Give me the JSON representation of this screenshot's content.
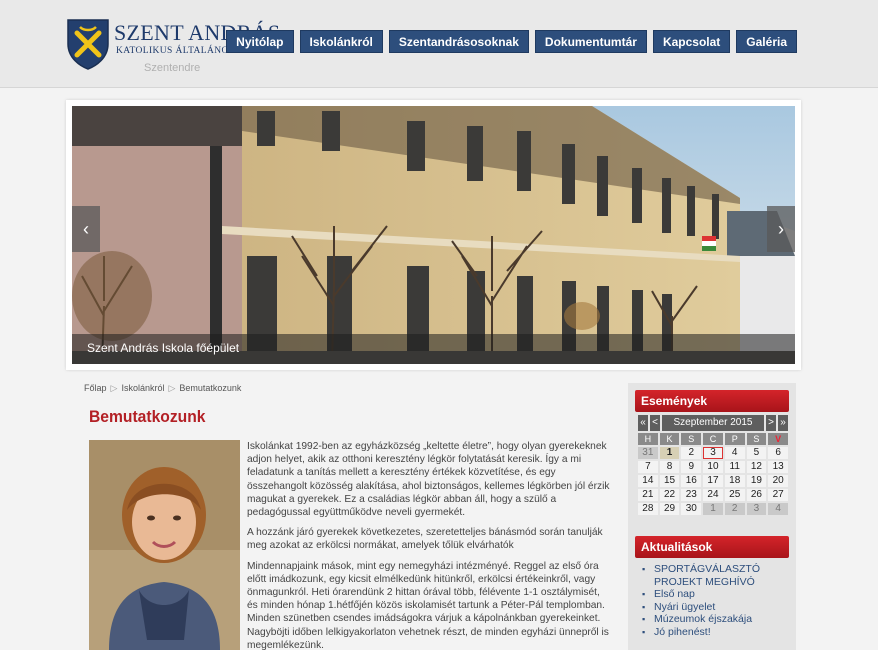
{
  "header": {
    "logo_title": "SZENT ANDRÁS",
    "logo_subtitle": "KATOLIKUS ÁLTALÁNOS ISKOLA",
    "logo_town": "Szentendre"
  },
  "nav": {
    "items": [
      "Nyitólap",
      "Iskolánkról",
      "Szentandrásosoknak",
      "Dokumentumtár",
      "Kapcsolat",
      "Galéria"
    ]
  },
  "slider": {
    "caption": "Szent András Iskola főépület",
    "prev_icon": "chevron-left-icon",
    "next_icon": "chevron-right-icon"
  },
  "breadcrumb": {
    "items": [
      "Főlap",
      "Iskolánkról",
      "Bemutatkozunk"
    ]
  },
  "article": {
    "title": "Bemutatkozunk",
    "paragraphs": [
      "Iskolánkat 1992-ben az egyházközség „keltette életre”, hogy olyan gyerekeknek adjon helyet, akik az otthoni keresztény légkör folytatását keresik. Így a mi feladatunk a tanítás mellett a keresztény értékek közvetítése, és egy összehangolt közösség alakítása, ahol biztonságos, kellemes légkörben jól érzik magukat a gyerekek. Ez a családias légkör abban áll, hogy a szülő a pedagógussal együttműködve neveli gyermekét.",
      "A hozzánk járó gyerekek következetes, szeretetteljes bánásmód során tanulják meg azokat az erkölcsi normákat, amelyek tőlük elvárhatók",
      "Mindennapjaink mások, mint egy nemegyházi intézményé. Reggel az első óra előtt imádkozunk, egy kicsit elmélkedünk hitünkről, erkölcsi értékeinkről, vagy önmagunkról. Heti órarendünk 2 hittan órával több, félévente 1-1 osztálymisét, és minden hónap 1.hétfőjén közös iskolamisét tartunk a Péter-Pál templomban. Minden szünetben csendes imádságokra várjuk a kápolnánkban gyerekeinket. Nagyböjti időben lelkigyakorlaton vehetnek részt, de minden egyházi ünnepről is megemlékezünk."
    ]
  },
  "events": {
    "title": "Események",
    "nav_first": "«",
    "nav_prev": "<",
    "month_label": "Szeptember 2015",
    "nav_next": ">",
    "nav_last": "»",
    "day_headers": [
      "H",
      "K",
      "S",
      "C",
      "P",
      "S",
      "V"
    ],
    "weeks": [
      [
        "31",
        "1",
        "2",
        "3",
        "4",
        "5",
        "6"
      ],
      [
        "7",
        "8",
        "9",
        "10",
        "11",
        "12",
        "13"
      ],
      [
        "14",
        "15",
        "16",
        "17",
        "18",
        "19",
        "20"
      ],
      [
        "21",
        "22",
        "23",
        "24",
        "25",
        "26",
        "27"
      ],
      [
        "28",
        "29",
        "30",
        "1",
        "2",
        "3",
        "4"
      ]
    ]
  },
  "news": {
    "title": "Aktualitások",
    "items": [
      "SPORTÁGVÁLASZTÓ PROJEKT MEGHÍVÓ",
      "Első nap",
      "Nyári ügyelet",
      "Múzeumok éjszakája",
      "Jó pihenést!"
    ]
  }
}
